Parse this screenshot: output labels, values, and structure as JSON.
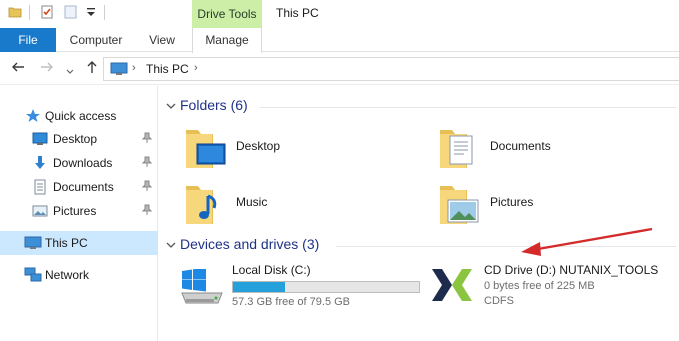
{
  "titlebar": {
    "context_tab_group": "Drive Tools",
    "window_title": "This PC"
  },
  "ribbon": {
    "tabs": [
      {
        "label": "File",
        "active": false
      },
      {
        "label": "Computer",
        "active": false
      },
      {
        "label": "View",
        "active": false
      },
      {
        "label": "Manage",
        "active": true
      }
    ],
    "file_color": "#1979ca",
    "context_color": "#cdeea7"
  },
  "address_bar": {
    "back_icon": "arrow-left-icon",
    "forward_icon": "arrow-right-icon",
    "recent_icon": "chevron-down-icon",
    "up_icon": "arrow-up-icon",
    "location_icon": "computer-icon",
    "path": [
      "This PC"
    ]
  },
  "nav_pane": {
    "quick_access": {
      "label": "Quick access",
      "icon": "star-icon"
    },
    "pinned": [
      {
        "label": "Desktop",
        "icon": "desktop-icon",
        "pinned": true
      },
      {
        "label": "Downloads",
        "icon": "download-icon",
        "pinned": true
      },
      {
        "label": "Documents",
        "icon": "document-icon",
        "pinned": true
      },
      {
        "label": "Pictures",
        "icon": "pictures-icon",
        "pinned": true
      }
    ],
    "this_pc": {
      "label": "This PC",
      "icon": "computer-icon",
      "selected": true
    },
    "network": {
      "label": "Network",
      "icon": "network-icon"
    }
  },
  "folders": {
    "header": "Folders (6)",
    "items": [
      {
        "label": "Desktop",
        "icon": "desktop-folder-icon"
      },
      {
        "label": "Documents",
        "icon": "documents-folder-icon"
      },
      {
        "label": "Music",
        "icon": "music-folder-icon"
      },
      {
        "label": "Pictures",
        "icon": "pictures-folder-icon"
      }
    ]
  },
  "devices": {
    "header": "Devices and drives (3)",
    "drives": [
      {
        "name": "Local Disk (C:)",
        "icon": "windows-drive-icon",
        "free_text": "57.3 GB free of 79.5 GB",
        "used_fraction": 0.279
      },
      {
        "name": "CD Drive (D:) NUTANIX_TOOLS",
        "icon": "nutanix-logo-icon",
        "free_text": "0 bytes free of 225 MB",
        "filesystem": "CDFS"
      }
    ]
  },
  "annotation": {
    "color": "#d42a2a"
  }
}
